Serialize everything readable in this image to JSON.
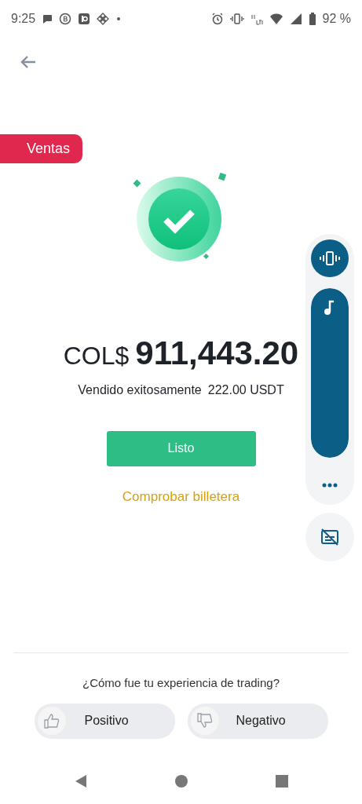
{
  "status_bar": {
    "time": "9:25",
    "battery": "92 %"
  },
  "badge": "Ventas",
  "amount": {
    "currency": "COL$",
    "value": "911,443.20"
  },
  "subtitle": {
    "label": "Vendido exitosamente",
    "quantity": "222.00 USDT"
  },
  "primary_button": "Listo",
  "link": "Comprobar billetera",
  "feedback": {
    "question": "¿Cómo fue tu experiencia de trading?",
    "options": [
      {
        "kind": "up",
        "label": "Positivo"
      },
      {
        "kind": "down",
        "label": "Negativo"
      }
    ]
  }
}
